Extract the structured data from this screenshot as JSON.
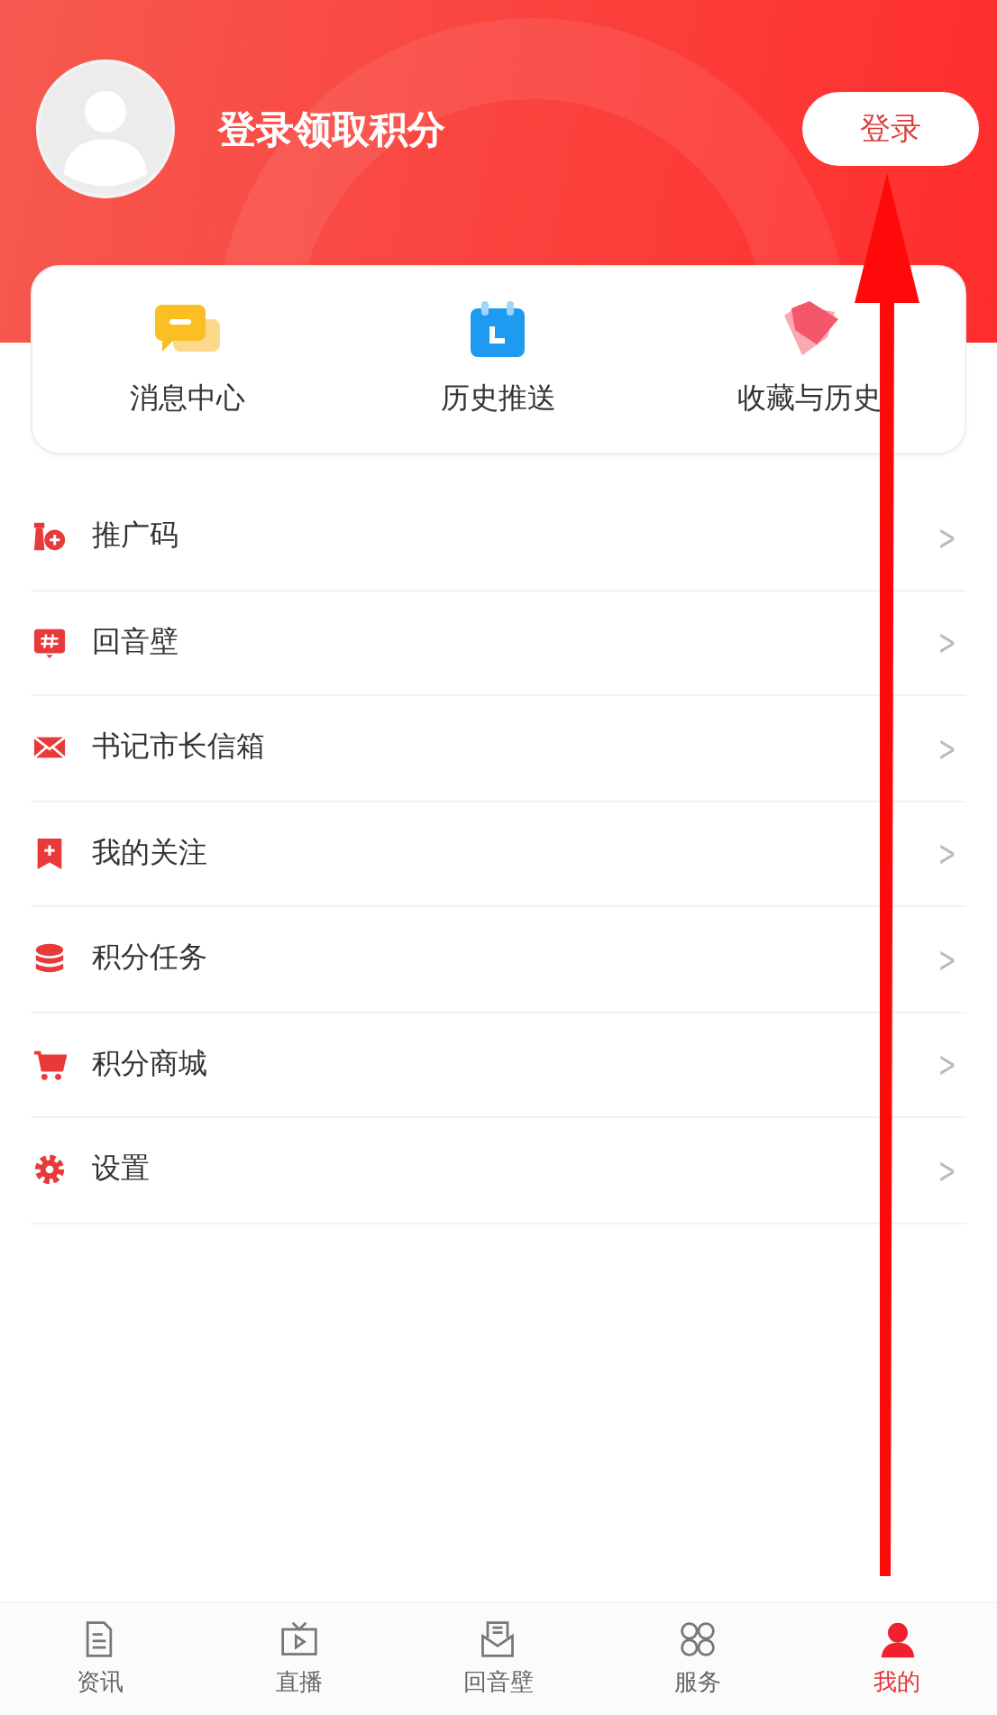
{
  "header": {
    "title": "登录领取积分",
    "login_button": "登录"
  },
  "shortcuts": [
    {
      "label": "消息中心"
    },
    {
      "label": "历史推送"
    },
    {
      "label": "收藏与历史"
    }
  ],
  "menu": [
    {
      "label": "推广码",
      "chevron": ">"
    },
    {
      "label": "回音壁",
      "chevron": ">"
    },
    {
      "label": "书记市长信箱",
      "chevron": ">"
    },
    {
      "label": "我的关注",
      "chevron": ">"
    },
    {
      "label": "积分任务",
      "chevron": ">"
    },
    {
      "label": "积分商城",
      "chevron": ">"
    },
    {
      "label": "设置",
      "chevron": ">"
    }
  ],
  "tabs": [
    {
      "label": "资讯",
      "selected": false
    },
    {
      "label": "直播",
      "selected": false
    },
    {
      "label": "回音壁",
      "selected": false
    },
    {
      "label": "服务",
      "selected": false
    },
    {
      "label": "我的",
      "selected": true
    }
  ]
}
